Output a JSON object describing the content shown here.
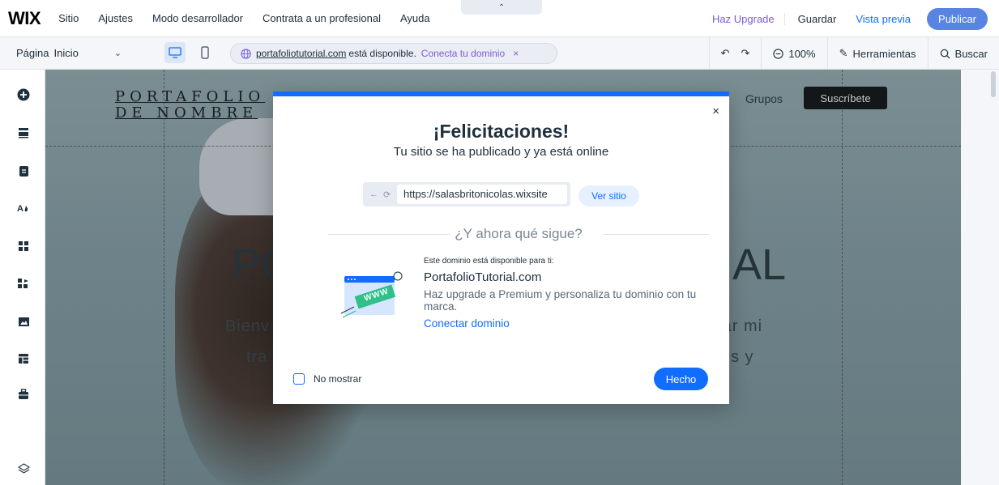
{
  "topbar": {
    "logo": "WIX",
    "menu": [
      "Sitio",
      "Ajustes",
      "Modo desarrollador",
      "Contrata a un profesional",
      "Ayuda"
    ],
    "upgrade": "Haz Upgrade",
    "save": "Guardar",
    "preview": "Vista previa",
    "publish": "Publicar"
  },
  "secondbar": {
    "page_label": "Página",
    "page_value": "Inicio",
    "domain_link": "portafoliotutorial.com",
    "domain_text": "está disponible.",
    "domain_cta": "Conecta tu dominio",
    "domain_close": "×",
    "zoom": "100%",
    "tools": "Herramientas",
    "search": "Buscar"
  },
  "canvas": {
    "brand_line1": "PORTAFOLIO",
    "brand_line2": "DE NOMBRE",
    "nav_groups": "Grupos",
    "subscribe": "Suscríbete",
    "hero_left": "PO",
    "hero_right": "AL",
    "sub_left": "Bienv",
    "sub_right": "rar mi",
    "sub_left2": "tra",
    "sub_right2": "s y"
  },
  "modal": {
    "title": "¡Felicitaciones!",
    "subtitle": "Tu sitio se ha publicado y ya está online",
    "url": "https://salasbritonicolas.wixsite",
    "view_site": "Ver sitio",
    "next_heading": "¿Y ahora qué sigue?",
    "domain_small": "Este dominio está disponible para ti:",
    "domain_name": "PortafolioTutorial.com",
    "domain_desc": "Haz upgrade a Premium y personaliza tu dominio con tu marca.",
    "domain_link": "Conectar dominio",
    "www_label": "WWW",
    "dont_show": "No mostrar",
    "done": "Hecho",
    "close": "×"
  },
  "colors": {
    "accent": "#116dff",
    "upgrade": "#7a5cd6",
    "publish_bg": "#3d6fdc"
  }
}
